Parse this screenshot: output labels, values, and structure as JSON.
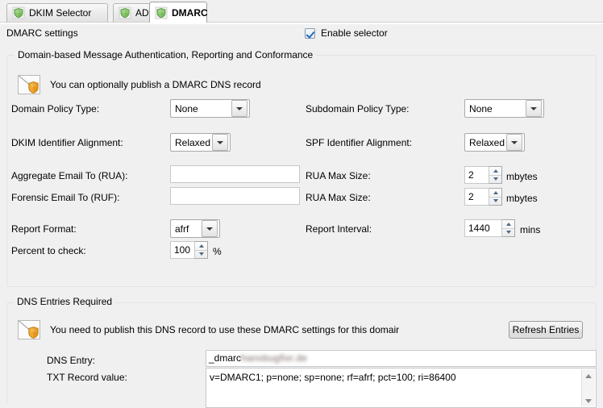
{
  "tabs": [
    {
      "label": "DKIM Selector",
      "icon": "shield-icon",
      "active": false
    },
    {
      "label": "ADSP",
      "icon": "shield-icon",
      "active": false
    },
    {
      "label": "DMARC",
      "icon": "shield-icon",
      "active": true
    }
  ],
  "header": {
    "settings_title": "DMARC settings",
    "enable_selector_label": "Enable selector",
    "enable_selector_checked": "true"
  },
  "dmarc_group": {
    "title": "Domain-based Message Authentication, Reporting and Conformance",
    "info_text": "You can optionally publish a DMARC DNS record",
    "info_icon": "envelope-shield-icon",
    "fields": {
      "domain_policy_label": "Domain Policy Type:",
      "domain_policy_value": "None",
      "subdomain_policy_label": "Subdomain Policy Type:",
      "subdomain_policy_value": "None",
      "dkim_alignment_label": "DKIM Identifier Alignment:",
      "dkim_alignment_value": "Relaxed",
      "spf_alignment_label": "SPF Identifier Alignment:",
      "spf_alignment_value": "Relaxed",
      "rua_label": "Aggregate Email To (RUA):",
      "rua_value": "",
      "ruf_label": "Forensic Email To (RUF):",
      "ruf_value": "",
      "rua_max_size_label": "RUA Max Size:",
      "rua_max_size_value": "2",
      "rua_max_size_unit": "mbytes",
      "ruf_max_size_label": "RUA Max Size:",
      "ruf_max_size_value": "2",
      "ruf_max_size_unit": "mbytes",
      "report_format_label": "Report Format:",
      "report_format_value": "afrf",
      "report_interval_label": "Report Interval:",
      "report_interval_value": "1440",
      "report_interval_unit": "mins",
      "percent_label": "Percent to check:",
      "percent_value": "100",
      "percent_unit": "%"
    }
  },
  "dns_group": {
    "title": "DNS Entries Required",
    "info_text": "You need to publish this DNS record to use these DMARC settings for this domair",
    "info_icon": "envelope-shield-icon",
    "refresh_button_label": "Refresh Entries",
    "dns_entry_label": "DNS Entry:",
    "dns_entry_prefix": "_dmarc",
    "dns_entry_domain": "hansbugfixr.de",
    "txt_record_label": "TXT Record value:",
    "txt_record_value": "v=DMARC1; p=none; sp=none; rf=afrf; pct=100; ri=86400"
  }
}
